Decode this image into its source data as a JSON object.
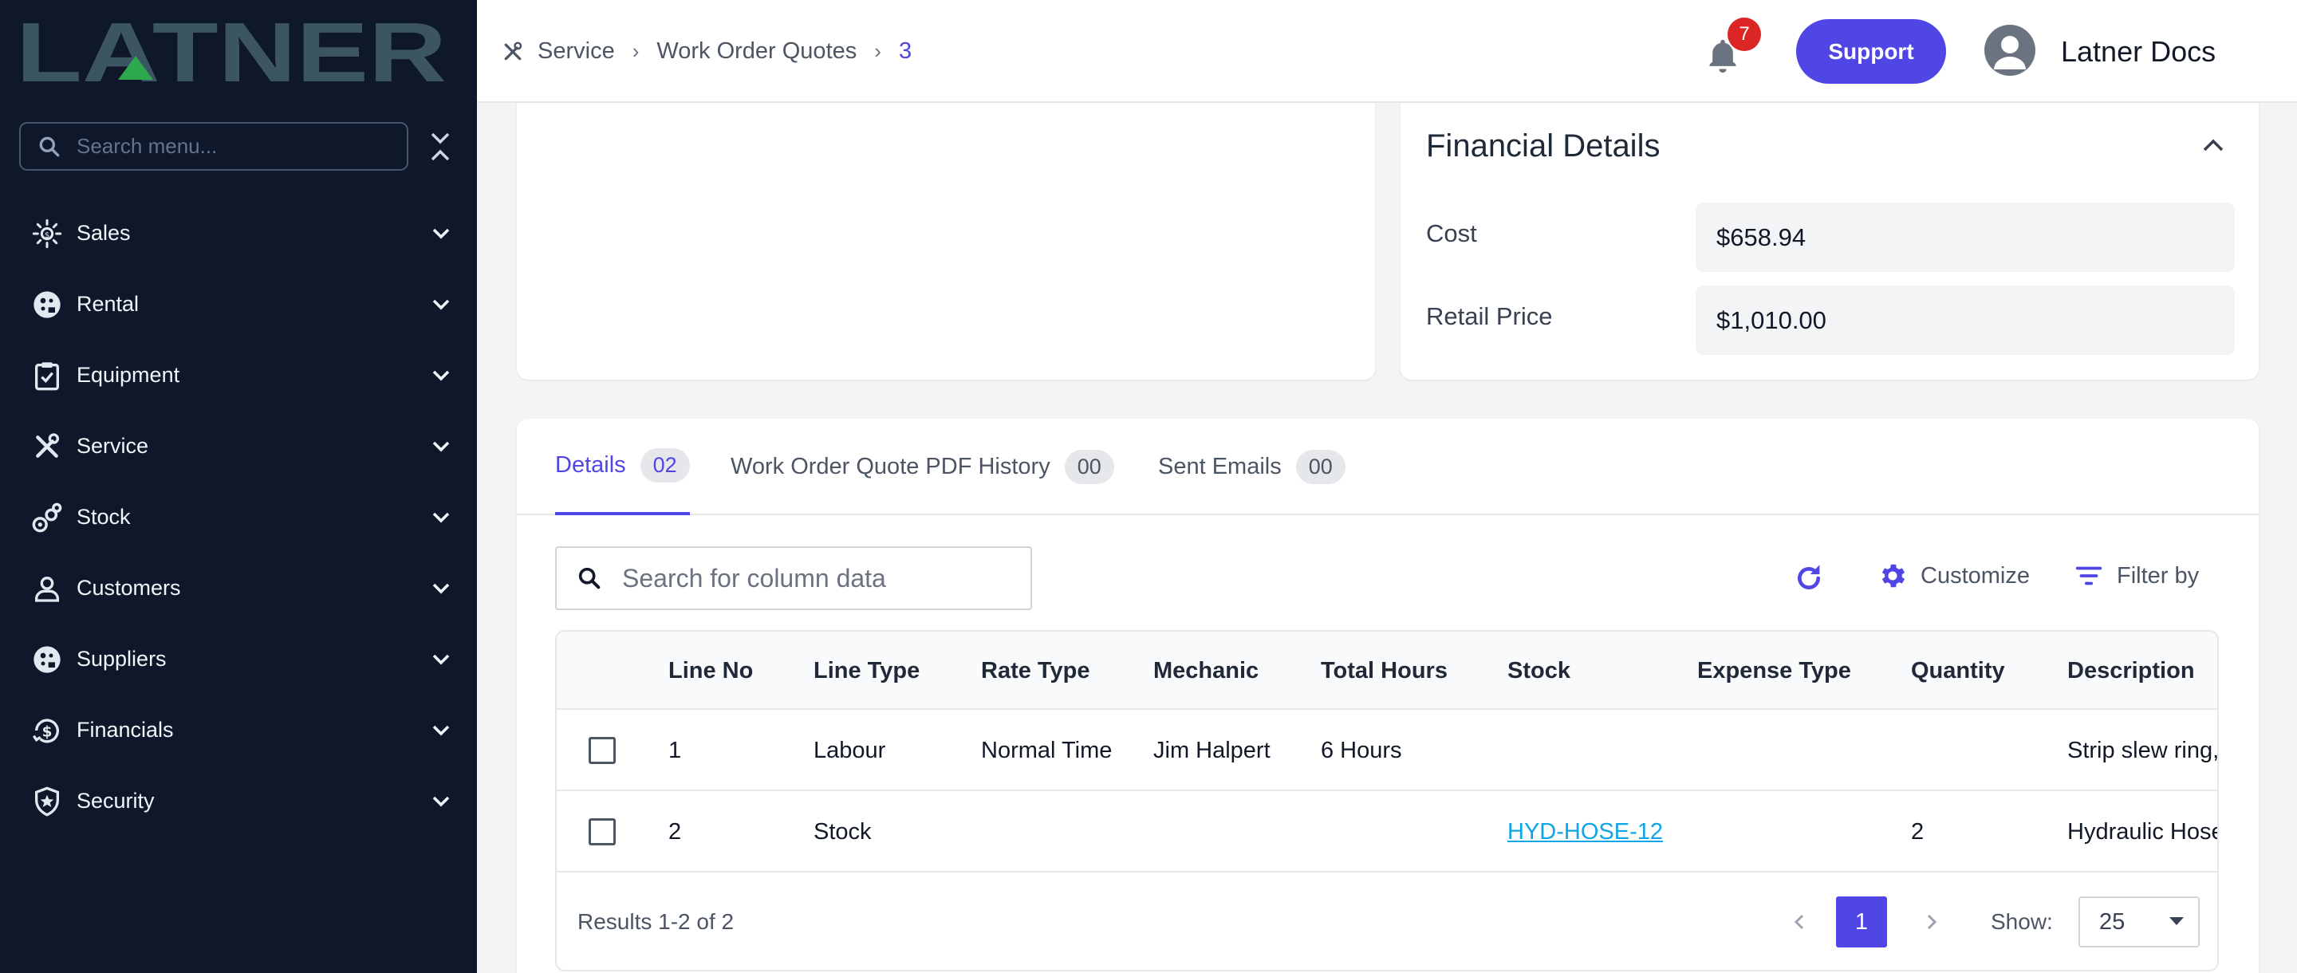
{
  "brand": {
    "name": "LATNER"
  },
  "sidebar": {
    "search_placeholder": "Search menu...",
    "items": [
      {
        "label": "Sales",
        "icon": "sales-icon"
      },
      {
        "label": "Rental",
        "icon": "rental-icon"
      },
      {
        "label": "Equipment",
        "icon": "equipment-icon"
      },
      {
        "label": "Service",
        "icon": "service-icon"
      },
      {
        "label": "Stock",
        "icon": "stock-icon"
      },
      {
        "label": "Customers",
        "icon": "customers-icon"
      },
      {
        "label": "Suppliers",
        "icon": "suppliers-icon"
      },
      {
        "label": "Financials",
        "icon": "financials-icon"
      },
      {
        "label": "Security",
        "icon": "security-icon"
      }
    ]
  },
  "header": {
    "breadcrumb": [
      "Service",
      "Work Order Quotes",
      "3"
    ],
    "notifications_count": "7",
    "support_label": "Support",
    "user_name": "Latner Docs"
  },
  "financial_details": {
    "title": "Financial Details",
    "fields": [
      {
        "label": "Cost",
        "value": "$658.94"
      },
      {
        "label": "Retail Price",
        "value": "$1,010.00"
      }
    ]
  },
  "tabs": [
    {
      "label": "Details",
      "count": "02",
      "active": true
    },
    {
      "label": "Work Order Quote PDF History",
      "count": "00",
      "active": false
    },
    {
      "label": "Sent Emails",
      "count": "00",
      "active": false
    }
  ],
  "toolbar": {
    "search_placeholder": "Search for column data",
    "customize_label": "Customize",
    "filter_label": "Filter by"
  },
  "table": {
    "columns": [
      "Line No",
      "Line Type",
      "Rate Type",
      "Mechanic",
      "Total Hours",
      "Stock",
      "Expense Type",
      "Quantity",
      "Description"
    ],
    "rows": [
      {
        "line_no": "1",
        "line_type": "Labour",
        "rate_type": "Normal Time",
        "mechanic": "Jim Halpert",
        "total_hours": "6 Hours",
        "stock": "",
        "expense_type": "",
        "quantity": "",
        "description": "Strip slew ring, i"
      },
      {
        "line_no": "2",
        "line_type": "Stock",
        "rate_type": "",
        "mechanic": "",
        "total_hours": "",
        "stock": "HYD-HOSE-12",
        "expense_type": "",
        "quantity": "2",
        "description": "Hydraulic Hose"
      }
    ]
  },
  "pagination": {
    "results_text": "Results 1-2 of 2",
    "current_page": "1",
    "show_label": "Show:",
    "page_size": "25"
  },
  "colors": {
    "sidebar_bg": "#0f172a",
    "accent": "#4f46e5",
    "logo": "#3b5563",
    "logo_accent": "#2ea84f",
    "badge": "#dc2626",
    "link": "#0ea5e9"
  }
}
